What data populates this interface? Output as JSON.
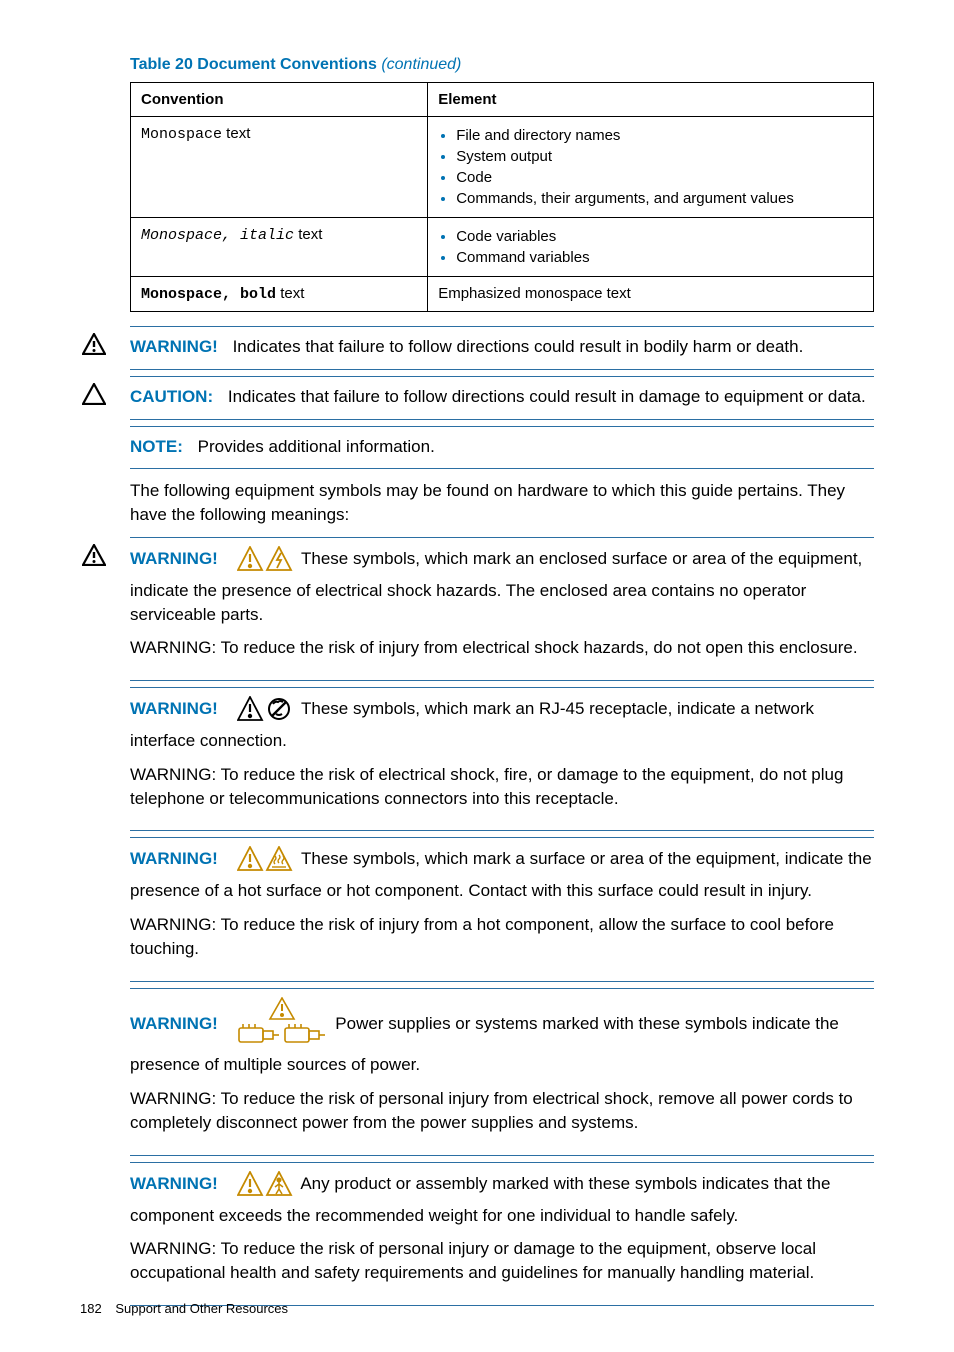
{
  "tableTitle": {
    "prefix": "Table 20 Document Conventions",
    "suffix": "(continued)"
  },
  "headers": {
    "c1": "Convention",
    "c2": "Element"
  },
  "rows": {
    "r1": {
      "conv": {
        "mono": "Monospace",
        "rest": "  text"
      },
      "items": {
        "a": "File and directory names",
        "b": "System output",
        "c": "Code",
        "d": "Commands, their arguments, and argument values"
      }
    },
    "r2": {
      "conv": {
        "mono": "Monospace, italic",
        "rest": " text"
      },
      "items": {
        "a": "Code variables",
        "b": "Command variables"
      }
    },
    "r3": {
      "conv": {
        "mono": "Monospace, bold",
        "rest": " text"
      },
      "elem": "Emphasized monospace text"
    }
  },
  "warn1": {
    "label": "WARNING!",
    "text": "Indicates that failure to follow directions could result in bodily harm or death."
  },
  "caution": {
    "label": "CAUTION:",
    "text": "Indicates that failure to follow directions could result in damage to equipment or data."
  },
  "note": {
    "label": "NOTE:",
    "text": "Provides additional information."
  },
  "intro": "The following equipment symbols may be found on hardware to which this guide pertains. They have the following meanings:",
  "w2": {
    "label": "WARNING!",
    "p1": " These symbols, which mark an enclosed surface or area of the equipment, indicate the presence of electrical shock hazards. The enclosed area contains no operator serviceable parts.",
    "p2": "WARNING: To reduce the risk of injury from electrical shock hazards, do not open this enclosure."
  },
  "w3": {
    "label": "WARNING!",
    "p1": " These symbols, which mark an RJ-45 receptacle, indicate a network interface connection.",
    "p2": "WARNING: To reduce the risk of electrical shock, fire, or damage to the equipment, do not plug telephone or telecommunications connectors into this receptacle."
  },
  "w4": {
    "label": "WARNING!",
    "p1": " These symbols, which mark a surface or area of the equipment, indicate the presence of a hot surface or hot component. Contact with this surface could result in injury.",
    "p2": "WARNING: To reduce the risk of injury from a hot component, allow the surface to cool before touching."
  },
  "w5": {
    "label": "WARNING!",
    "p1": " Power supplies or systems marked with these symbols indicate the presence of multiple sources of power.",
    "p2": "WARNING: To reduce the risk of personal injury from electrical shock, remove all power cords to completely disconnect power from the power supplies and systems."
  },
  "w6": {
    "label": "WARNING!",
    "p1": " Any product or assembly marked with these symbols indicates that the component exceeds the recommended weight for one individual to handle safely.",
    "p2": "WARNING: To reduce the risk of personal injury or damage to the equipment, observe local occupational health and safety requirements and guidelines for manually handling material."
  },
  "footer": {
    "page": "182",
    "section": "Support and Other Resources"
  }
}
